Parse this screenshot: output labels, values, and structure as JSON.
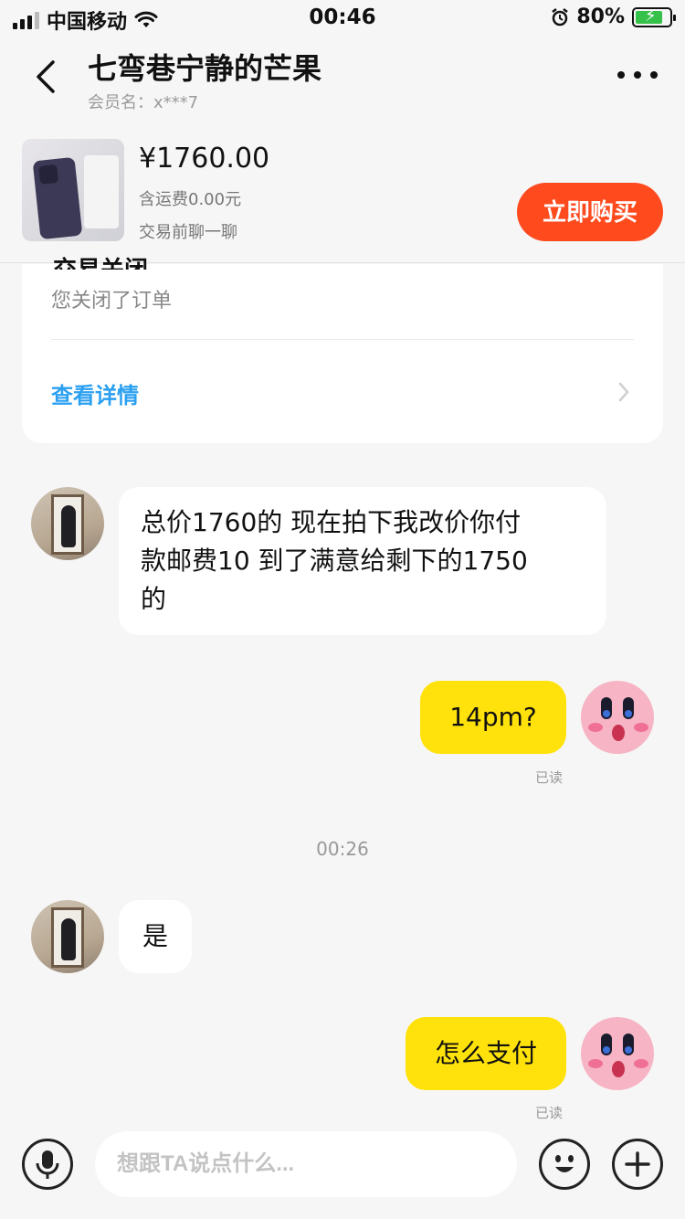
{
  "status_bar": {
    "carrier": "中国移动",
    "time": "00:46",
    "battery": "80%"
  },
  "header": {
    "title": "七弯巷宁静的芒果",
    "subtitle": "会员名：x***7"
  },
  "product": {
    "price": "¥1760.00",
    "shipping": "含运费0.00元",
    "hint": "交易前聊一聊",
    "buy_label": "立即购买"
  },
  "order_card": {
    "partial_title": "交易关闭",
    "status": "您关闭了订单",
    "detail_link": "查看详情"
  },
  "messages": [
    {
      "side": "in",
      "lines": [
        "总价1760的 现在拍下我改价你付",
        "款邮费10 到了满意给剩下的1750",
        "的"
      ]
    },
    {
      "side": "out",
      "text": "14pm?",
      "status": "已读"
    },
    {
      "side": "time",
      "text": "00:26"
    },
    {
      "side": "in",
      "text": "是"
    },
    {
      "side": "out",
      "text": "怎么支付",
      "status": "已读"
    }
  ],
  "input": {
    "placeholder": "想跟TA说点什么..."
  },
  "icons": {
    "back": "chevron-left-icon",
    "more": "more-dots-icon",
    "mic": "microphone-icon",
    "emoji": "smiley-icon",
    "plus": "plus-icon"
  },
  "colors": {
    "buy_button": "#ff4a1e",
    "outgoing_bubble": "#ffe20b",
    "link": "#2ba0f0",
    "background": "#f6f6f6"
  }
}
